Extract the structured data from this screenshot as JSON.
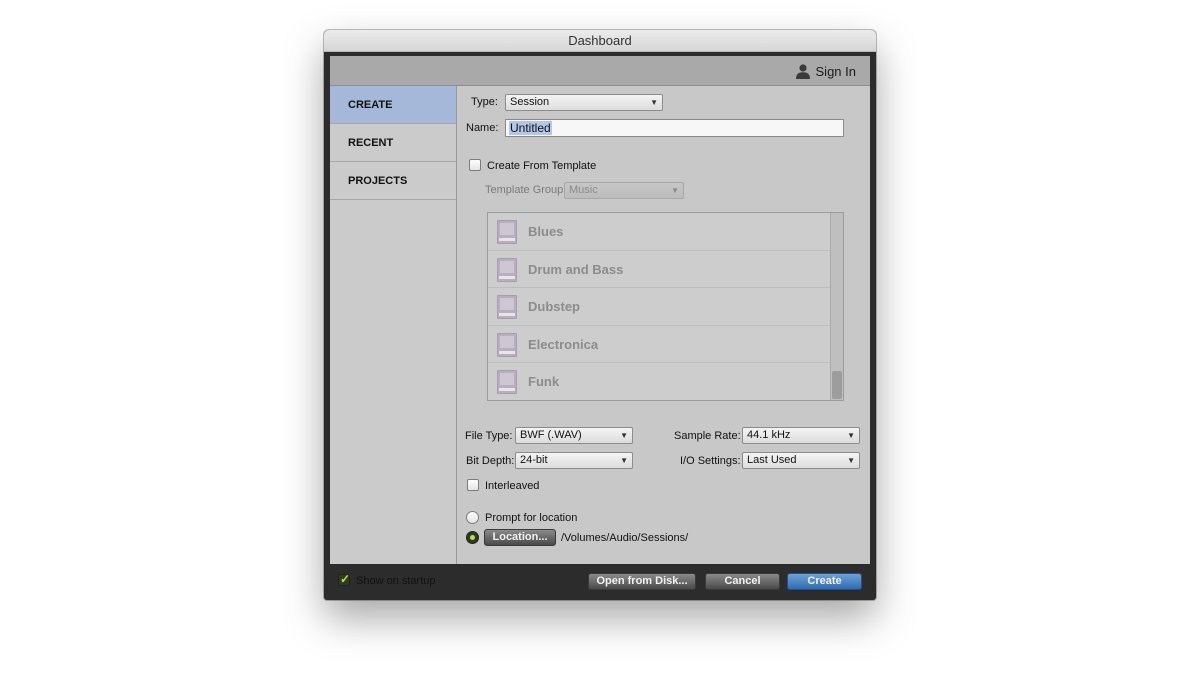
{
  "window": {
    "title": "Dashboard"
  },
  "header": {
    "sign_in_label": "Sign In",
    "sign_in_icon": "user-icon"
  },
  "sidebar": {
    "items": [
      {
        "label": "CREATE",
        "active": true
      },
      {
        "label": "RECENT",
        "active": false
      },
      {
        "label": "PROJECTS",
        "active": false
      }
    ]
  },
  "create": {
    "type_label": "Type:",
    "type_value": "Session",
    "name_label": "Name:",
    "name_value": "Untitled",
    "from_template_label": "Create From Template",
    "from_template_checked": false,
    "template_group_label": "Template Group:",
    "template_group_value": "Music",
    "templates": [
      "Blues",
      "Drum and Bass",
      "Dubstep",
      "Electronica",
      "Funk"
    ],
    "file_type_label": "File Type:",
    "file_type_value": "BWF (.WAV)",
    "sample_rate_label": "Sample Rate:",
    "sample_rate_value": "44.1 kHz",
    "bit_depth_label": "Bit Depth:",
    "bit_depth_value": "24-bit",
    "io_settings_label": "I/O Settings:",
    "io_settings_value": "Last Used",
    "interleaved_label": "Interleaved",
    "interleaved_checked": false,
    "prompt_location_label": "Prompt for location",
    "location_button_label": "Location...",
    "location_path": "/Volumes/Audio/Sessions/",
    "location_option_selected": "location"
  },
  "footer": {
    "show_on_startup_label": "Show on startup",
    "show_on_startup_checked": true,
    "open_from_disk_label": "Open from Disk...",
    "cancel_label": "Cancel",
    "create_label": "Create"
  },
  "colors": {
    "accent_blue": "#2f6db4",
    "sidebar_active": "#a5b8d9",
    "radio_on": "#b9e23a"
  }
}
